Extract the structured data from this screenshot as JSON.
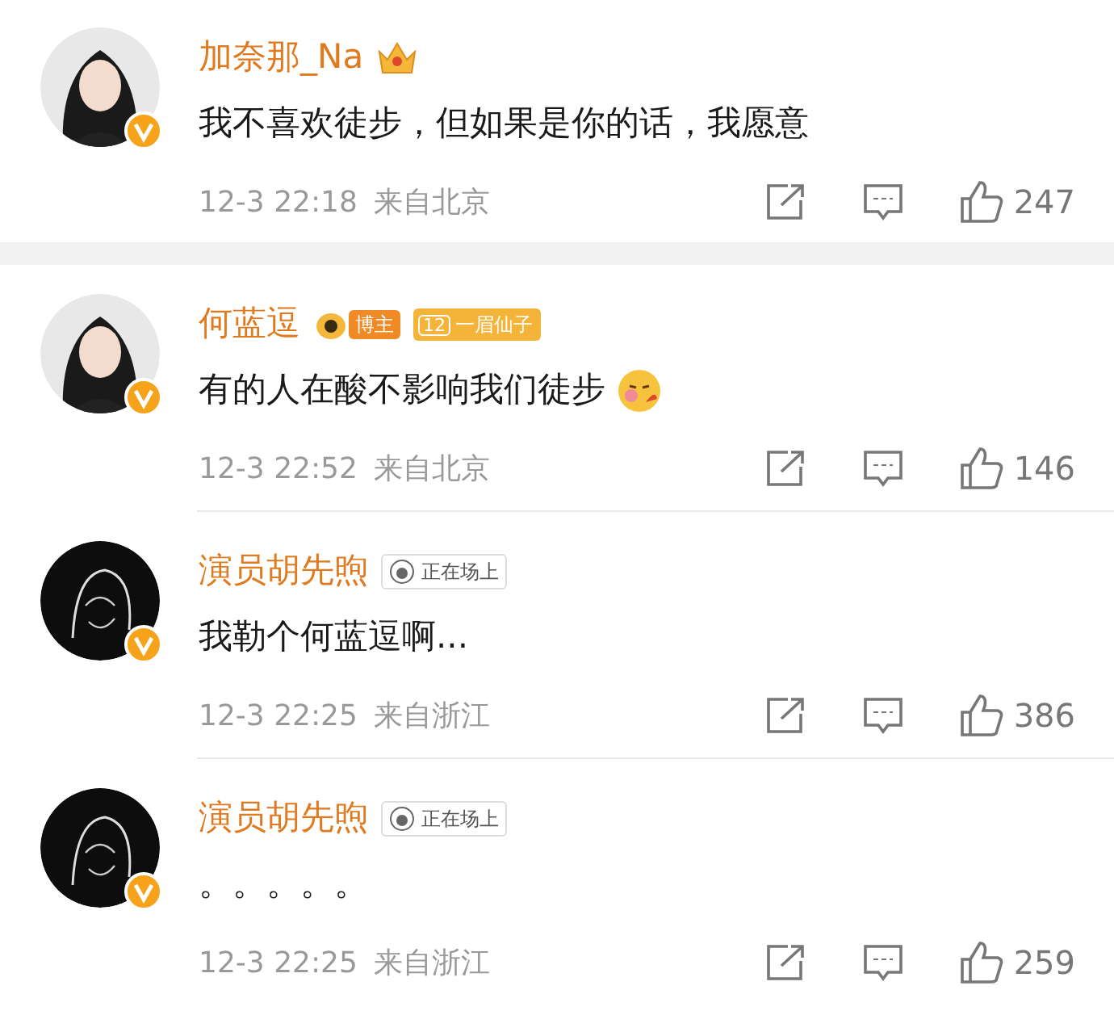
{
  "comments": [
    {
      "name": "加奈那_Na",
      "badges": [
        {
          "kind": "crown"
        }
      ],
      "text": "我不喜欢徒步，但如果是你的话，我愿意",
      "emoji": false,
      "time": "12-3 22:18",
      "source": "来自北京",
      "likes": "247"
    },
    {
      "name": "何蓝逗",
      "badges": [
        {
          "kind": "blogger",
          "label": "博主"
        },
        {
          "kind": "level",
          "level_text": "12",
          "label": "一眉仙子"
        }
      ],
      "text": "有的人在酸不影响我们徒步",
      "emoji": true,
      "time": "12-3 22:52",
      "source": "来自北京",
      "likes": "146"
    },
    {
      "name": "演员胡先煦",
      "badges": [
        {
          "kind": "status",
          "label": "正在场上"
        }
      ],
      "text": "我勒个何蓝逗啊...",
      "emoji": false,
      "time": "12-3 22:25",
      "source": "来自浙江",
      "likes": "386"
    },
    {
      "name": "演员胡先煦",
      "badges": [
        {
          "kind": "status",
          "label": "正在场上"
        }
      ],
      "text": "。。。。。",
      "emoji": false,
      "time": "12-3 22:25",
      "source": "来自浙江",
      "likes": "259"
    }
  ]
}
